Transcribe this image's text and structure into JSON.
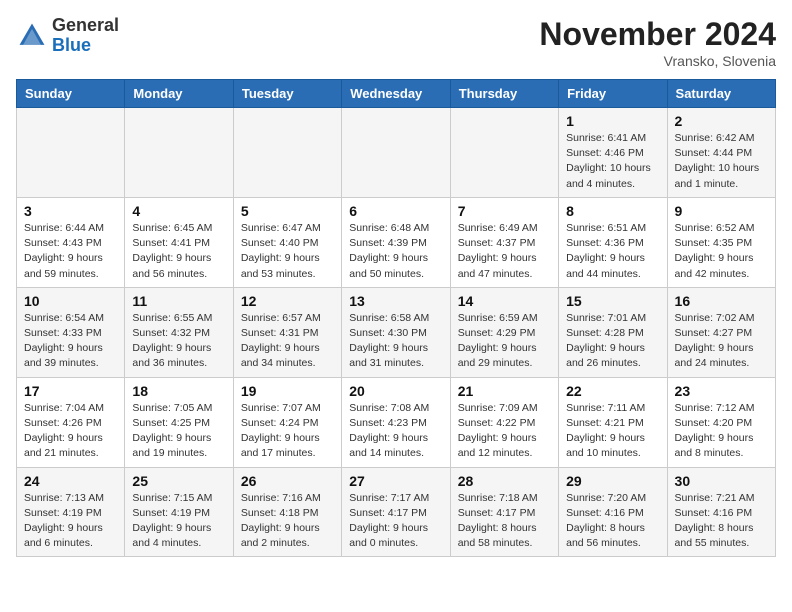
{
  "logo": {
    "general": "General",
    "blue": "Blue"
  },
  "title": "November 2024",
  "location": "Vransko, Slovenia",
  "days_of_week": [
    "Sunday",
    "Monday",
    "Tuesday",
    "Wednesday",
    "Thursday",
    "Friday",
    "Saturday"
  ],
  "weeks": [
    [
      {
        "day": "",
        "info": ""
      },
      {
        "day": "",
        "info": ""
      },
      {
        "day": "",
        "info": ""
      },
      {
        "day": "",
        "info": ""
      },
      {
        "day": "",
        "info": ""
      },
      {
        "day": "1",
        "info": "Sunrise: 6:41 AM\nSunset: 4:46 PM\nDaylight: 10 hours\nand 4 minutes."
      },
      {
        "day": "2",
        "info": "Sunrise: 6:42 AM\nSunset: 4:44 PM\nDaylight: 10 hours\nand 1 minute."
      }
    ],
    [
      {
        "day": "3",
        "info": "Sunrise: 6:44 AM\nSunset: 4:43 PM\nDaylight: 9 hours\nand 59 minutes."
      },
      {
        "day": "4",
        "info": "Sunrise: 6:45 AM\nSunset: 4:41 PM\nDaylight: 9 hours\nand 56 minutes."
      },
      {
        "day": "5",
        "info": "Sunrise: 6:47 AM\nSunset: 4:40 PM\nDaylight: 9 hours\nand 53 minutes."
      },
      {
        "day": "6",
        "info": "Sunrise: 6:48 AM\nSunset: 4:39 PM\nDaylight: 9 hours\nand 50 minutes."
      },
      {
        "day": "7",
        "info": "Sunrise: 6:49 AM\nSunset: 4:37 PM\nDaylight: 9 hours\nand 47 minutes."
      },
      {
        "day": "8",
        "info": "Sunrise: 6:51 AM\nSunset: 4:36 PM\nDaylight: 9 hours\nand 44 minutes."
      },
      {
        "day": "9",
        "info": "Sunrise: 6:52 AM\nSunset: 4:35 PM\nDaylight: 9 hours\nand 42 minutes."
      }
    ],
    [
      {
        "day": "10",
        "info": "Sunrise: 6:54 AM\nSunset: 4:33 PM\nDaylight: 9 hours\nand 39 minutes."
      },
      {
        "day": "11",
        "info": "Sunrise: 6:55 AM\nSunset: 4:32 PM\nDaylight: 9 hours\nand 36 minutes."
      },
      {
        "day": "12",
        "info": "Sunrise: 6:57 AM\nSunset: 4:31 PM\nDaylight: 9 hours\nand 34 minutes."
      },
      {
        "day": "13",
        "info": "Sunrise: 6:58 AM\nSunset: 4:30 PM\nDaylight: 9 hours\nand 31 minutes."
      },
      {
        "day": "14",
        "info": "Sunrise: 6:59 AM\nSunset: 4:29 PM\nDaylight: 9 hours\nand 29 minutes."
      },
      {
        "day": "15",
        "info": "Sunrise: 7:01 AM\nSunset: 4:28 PM\nDaylight: 9 hours\nand 26 minutes."
      },
      {
        "day": "16",
        "info": "Sunrise: 7:02 AM\nSunset: 4:27 PM\nDaylight: 9 hours\nand 24 minutes."
      }
    ],
    [
      {
        "day": "17",
        "info": "Sunrise: 7:04 AM\nSunset: 4:26 PM\nDaylight: 9 hours\nand 21 minutes."
      },
      {
        "day": "18",
        "info": "Sunrise: 7:05 AM\nSunset: 4:25 PM\nDaylight: 9 hours\nand 19 minutes."
      },
      {
        "day": "19",
        "info": "Sunrise: 7:07 AM\nSunset: 4:24 PM\nDaylight: 9 hours\nand 17 minutes."
      },
      {
        "day": "20",
        "info": "Sunrise: 7:08 AM\nSunset: 4:23 PM\nDaylight: 9 hours\nand 14 minutes."
      },
      {
        "day": "21",
        "info": "Sunrise: 7:09 AM\nSunset: 4:22 PM\nDaylight: 9 hours\nand 12 minutes."
      },
      {
        "day": "22",
        "info": "Sunrise: 7:11 AM\nSunset: 4:21 PM\nDaylight: 9 hours\nand 10 minutes."
      },
      {
        "day": "23",
        "info": "Sunrise: 7:12 AM\nSunset: 4:20 PM\nDaylight: 9 hours\nand 8 minutes."
      }
    ],
    [
      {
        "day": "24",
        "info": "Sunrise: 7:13 AM\nSunset: 4:19 PM\nDaylight: 9 hours\nand 6 minutes."
      },
      {
        "day": "25",
        "info": "Sunrise: 7:15 AM\nSunset: 4:19 PM\nDaylight: 9 hours\nand 4 minutes."
      },
      {
        "day": "26",
        "info": "Sunrise: 7:16 AM\nSunset: 4:18 PM\nDaylight: 9 hours\nand 2 minutes."
      },
      {
        "day": "27",
        "info": "Sunrise: 7:17 AM\nSunset: 4:17 PM\nDaylight: 9 hours\nand 0 minutes."
      },
      {
        "day": "28",
        "info": "Sunrise: 7:18 AM\nSunset: 4:17 PM\nDaylight: 8 hours\nand 58 minutes."
      },
      {
        "day": "29",
        "info": "Sunrise: 7:20 AM\nSunset: 4:16 PM\nDaylight: 8 hours\nand 56 minutes."
      },
      {
        "day": "30",
        "info": "Sunrise: 7:21 AM\nSunset: 4:16 PM\nDaylight: 8 hours\nand 55 minutes."
      }
    ]
  ]
}
